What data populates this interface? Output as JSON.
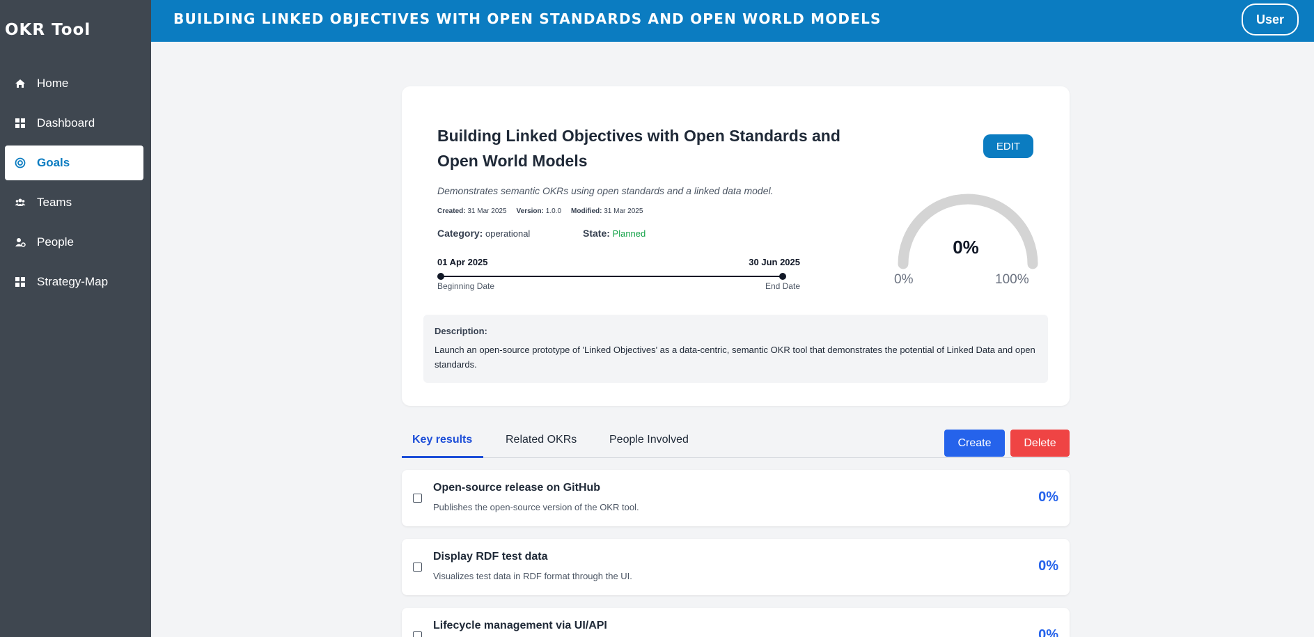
{
  "app": {
    "brand": "OKR Tool",
    "header_title": "BUILDING LINKED OBJECTIVES WITH OPEN STANDARDS AND OPEN WORLD MODELS",
    "user_label": "User"
  },
  "sidebar": {
    "items": [
      {
        "label": "Home",
        "icon": "home-icon"
      },
      {
        "label": "Dashboard",
        "icon": "grid-icon"
      },
      {
        "label": "Goals",
        "icon": "target-icon",
        "active": true
      },
      {
        "label": "Teams",
        "icon": "users-icon"
      },
      {
        "label": "People",
        "icon": "user-gear-icon"
      },
      {
        "label": "Strategy-Map",
        "icon": "grid-icon"
      }
    ]
  },
  "goal": {
    "title": "Building Linked Objectives with Open Standards and Open World Models",
    "edit_label": "EDIT",
    "subtitle": "Demonstrates semantic OKRs using open standards and a linked data model.",
    "meta": {
      "created_label": "Created:",
      "created": "31 Mar 2025",
      "version_label": "Version:",
      "version": "1.0.0",
      "modified_label": "Modified:",
      "modified": "31 Mar 2025"
    },
    "category_label": "Category:",
    "category": "operational",
    "state_label": "State:",
    "state": "Planned",
    "start_date": "01 Apr 2025",
    "end_date": "30 Jun 2025",
    "start_label": "Beginning Date",
    "end_label": "End Date",
    "progress": {
      "value_text": "0%",
      "value": 0,
      "min": "0%",
      "max": "100%"
    },
    "description_label": "Description:",
    "description": "Launch an open-source prototype of 'Linked Objectives' as a data-centric, semantic OKR tool that demonstrates the potential of Linked Data and open standards."
  },
  "tabs": {
    "items": [
      "Key results",
      "Related OKRs",
      "People Involved"
    ],
    "create_label": "Create",
    "delete_label": "Delete"
  },
  "key_results": [
    {
      "title": "Open-source release on GitHub",
      "description": "Publishes the open-source version of the OKR tool.",
      "progress": "0%"
    },
    {
      "title": "Display RDF test data",
      "description": "Visualizes test data in RDF format through the UI.",
      "progress": "0%"
    },
    {
      "title": "Lifecycle management via UI/API",
      "description": "",
      "progress": "0%"
    }
  ],
  "colors": {
    "primary": "#0b7cc1",
    "sidebar": "#3f4750",
    "state": "#16a34a",
    "create": "#2563eb",
    "delete": "#ef4444"
  }
}
